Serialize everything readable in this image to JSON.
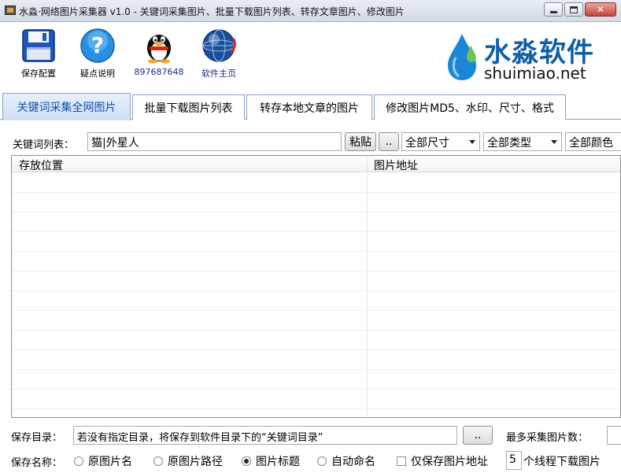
{
  "window": {
    "title": "水淼·网络图片采集器 v1.0 - 关键词采集图片、批量下载图片列表、转存文章图片、修改图片"
  },
  "toolbar": {
    "save_config": "保存配置",
    "help": "疑点说明",
    "qq": "897687648",
    "homepage": "软件主页"
  },
  "brand": {
    "cn": "水淼软件",
    "en": "shuimiao.net"
  },
  "tabs": [
    {
      "label": "关键词采集全网图片",
      "active": true
    },
    {
      "label": "批量下载图片列表",
      "active": false
    },
    {
      "label": "转存本地文章的图片",
      "active": false
    },
    {
      "label": "修改图片MD5、水印、尺寸、格式",
      "active": false
    }
  ],
  "keyword": {
    "label": "关键词列表：",
    "value": "猫|外星人",
    "paste": "粘贴",
    "browse": "..",
    "size_select": "全部尺寸",
    "type_select": "全部类型",
    "color_select": "全部颜色"
  },
  "table": {
    "columns": [
      "存放位置",
      "图片地址"
    ]
  },
  "save_dir": {
    "label": "保存目录：",
    "value": "若没有指定目录，将保存到软件目录下的“关键词目录”",
    "browse": "..",
    "max_label": "最多采集图片数："
  },
  "save_name": {
    "label": "保存名称：",
    "options": [
      {
        "label": "原图片名",
        "selected": false
      },
      {
        "label": "原图片路径",
        "selected": false
      },
      {
        "label": "图片标题",
        "selected": true
      },
      {
        "label": "自动命名",
        "selected": false
      }
    ],
    "url_only": "仅保存图片地址",
    "threads_value": "5",
    "threads_label": "个线程下载图片"
  }
}
